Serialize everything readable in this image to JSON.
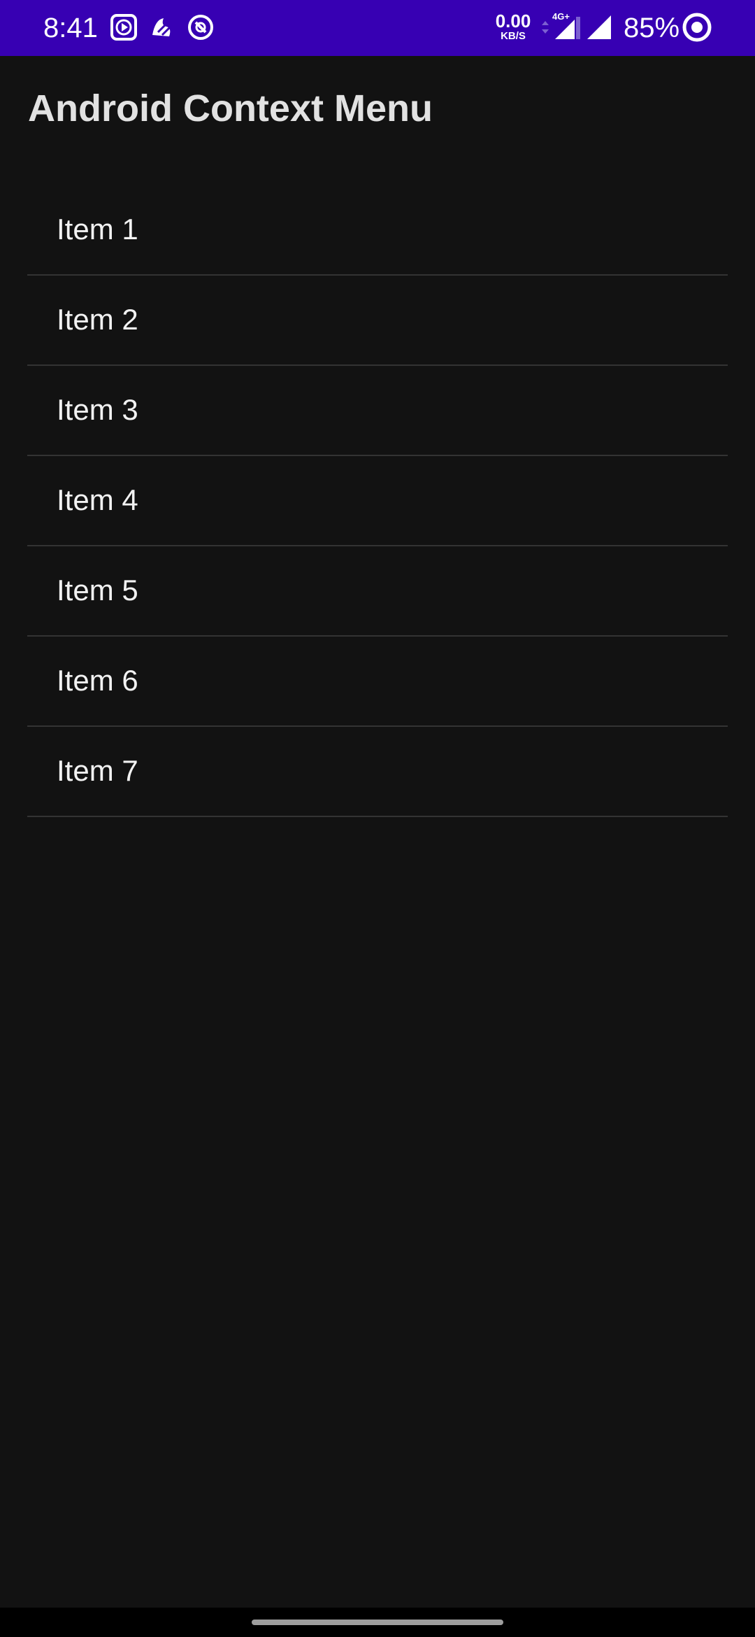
{
  "status_bar": {
    "time": "8:41",
    "net_speed_value": "0.00",
    "net_speed_unit": "KB/S",
    "network_type": "4G+",
    "battery": "85%",
    "background_color": "#3700b3",
    "icons": [
      "screen-recorder-icon",
      "app-notification-icon",
      "data-saver-icon",
      "network-arrows-icon",
      "signal-4g-icon",
      "wifi-signal-icon",
      "battery-ring-icon"
    ]
  },
  "app": {
    "title": "Android Context Menu"
  },
  "list": {
    "items": [
      {
        "label": "Item 1"
      },
      {
        "label": "Item 2"
      },
      {
        "label": "Item 3"
      },
      {
        "label": "Item 4"
      },
      {
        "label": "Item 5"
      },
      {
        "label": "Item 6"
      },
      {
        "label": "Item 7"
      }
    ]
  },
  "colors": {
    "background": "#121212",
    "divider": "#333333",
    "title_text": "#e2e2e2",
    "item_text": "#f2f2f2"
  }
}
